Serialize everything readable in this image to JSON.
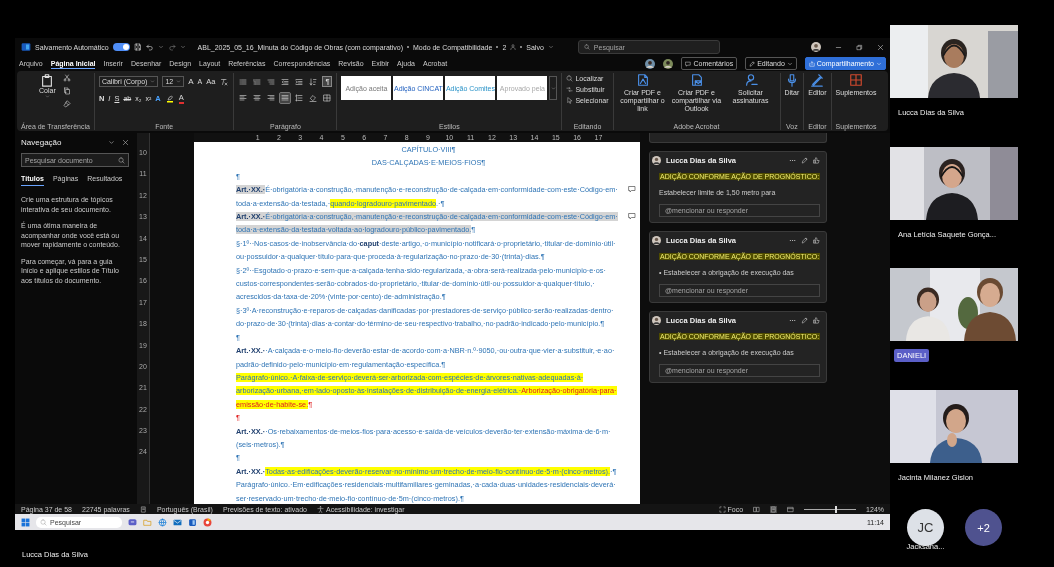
{
  "title_bar": {
    "autosave_label": "Salvamento Automático",
    "autosave_on": true,
    "document_title": "ABL_2025_05_16_Minuta do Código de Obras (com comparativo)",
    "mode": "Modo de Compatibilidade",
    "sensitivity": "2",
    "status": "Salvo",
    "search_placeholder": "Pesquisar"
  },
  "menu_tabs": [
    {
      "label": "Arquivo",
      "selected": false
    },
    {
      "label": "Página Inicial",
      "selected": true
    },
    {
      "label": "Inserir",
      "selected": false
    },
    {
      "label": "Desenhar",
      "selected": false
    },
    {
      "label": "Design",
      "selected": false
    },
    {
      "label": "Layout",
      "selected": false
    },
    {
      "label": "Referências",
      "selected": false
    },
    {
      "label": "Correspondências",
      "selected": false
    },
    {
      "label": "Revisão",
      "selected": false
    },
    {
      "label": "Exibir",
      "selected": false
    },
    {
      "label": "Ajuda",
      "selected": false
    },
    {
      "label": "Acrobat",
      "selected": false
    }
  ],
  "header_buttons": [
    {
      "label": "Comentários",
      "kind": "outline"
    },
    {
      "label": "Editando",
      "kind": "dropdown"
    },
    {
      "label": "Compartilhamento",
      "kind": "primary"
    }
  ],
  "ribbon": {
    "clipboard": {
      "paste": "Colar",
      "label": "Área de Transferência"
    },
    "font": {
      "name": "Calibri (Corpo)",
      "size": "12",
      "size_buttons": [
        "A",
        "A"
      ],
      "case_button": "Aa",
      "format_buttons": [
        {
          "text": "N",
          "kind": "bold"
        },
        {
          "text": "I",
          "kind": "italic"
        },
        {
          "text": "S",
          "kind": "underline"
        },
        {
          "text": "ab",
          "kind": "strike"
        },
        {
          "text": "x₂",
          "kind": "sub"
        },
        {
          "text": "x²",
          "kind": "sup"
        }
      ],
      "effects_letter": "A",
      "color_letter": "A",
      "label": "Fonte"
    },
    "paragraph": {
      "label": "Parágrafo",
      "show_marks": {
        "glyph": "¶",
        "on": true
      },
      "alignment_buttons": [
        {
          "selected": false
        },
        {
          "selected": false
        },
        {
          "selected": false
        },
        {
          "selected": true
        }
      ]
    },
    "styles": {
      "label": "Estilos",
      "items": [
        {
          "label": "Adição aceita",
          "kind": "grey"
        },
        {
          "label": "Adição CINCAT",
          "kind": "blue"
        },
        {
          "label": "Adição Comites",
          "kind": "cyan"
        },
        {
          "label": "Aprovado pela",
          "kind": "faint"
        }
      ]
    },
    "editing": {
      "label": "Editando",
      "items": [
        "Localizar",
        "Substituir",
        "Selecionar"
      ]
    },
    "acrobat": {
      "label": "Adobe Acrobat",
      "items": [
        "Criar PDF e compartilhar o link",
        "Criar PDF e compartilhar via Outlook",
        "Solicitar assinaturas"
      ]
    },
    "voice": {
      "label": "Voz",
      "button": "Ditar"
    },
    "editor": {
      "label": "Editor",
      "button": "Editor"
    },
    "addins": {
      "label": "Suplementos",
      "button": "Suplementos"
    }
  },
  "navigation": {
    "title": "Navegação",
    "search_placeholder": "Pesquisar documento",
    "tabs": [
      {
        "label": "Títulos",
        "selected": true
      },
      {
        "label": "Páginas",
        "selected": false
      },
      {
        "label": "Resultados",
        "selected": false
      }
    ],
    "messages": [
      "Crie uma estrutura de tópicos interativa de seu documento.",
      "É uma ótima maneira de acompanhar onde você está ou mover rapidamente o conteúdo.",
      "Para começar, vá para a guia Início e aplique estilos de Título aos títulos do documento."
    ]
  },
  "rulers": {
    "horizontal": [
      "1",
      "2",
      "3",
      "4",
      "5",
      "6",
      "7",
      "8",
      "9",
      "10",
      "11",
      "12",
      "13",
      "14",
      "15",
      "16",
      "17"
    ],
    "vertical": [
      "10",
      "11",
      "12",
      "13",
      "14",
      "15",
      "16",
      "17",
      "18",
      "19",
      "20",
      "21",
      "22",
      "23",
      "24"
    ]
  },
  "document": {
    "paragraphs": [
      {
        "centered": true,
        "runs": [
          {
            "text": "CAPÍTULO·VIII¶",
            "kind": "plain"
          }
        ]
      },
      {
        "centered": true,
        "runs": [
          {
            "text": "DAS·CALÇADAS·E·MEIOS·FIOS¶",
            "kind": "plain"
          }
        ]
      },
      {
        "centered": false,
        "runs": [
          {
            "text": "¶",
            "kind": "plain"
          }
        ]
      },
      {
        "centered": false,
        "comment": true,
        "runs": [
          {
            "text": "Art.·XX.·",
            "bold": true,
            "kind": "shaded"
          },
          {
            "text": "É·obrigatória·a·construção,·manutenção·e·reconstrução·de·calçada·em·conformidade·com·este·Código·em·toda·a·extensão·da·testada,·",
            "kind": "plain"
          },
          {
            "text": "quando·logradouro·pavimentado",
            "kind": "highlighted"
          },
          {
            "text": ".·¶",
            "kind": "plain"
          }
        ]
      },
      {
        "centered": false,
        "comment": true,
        "runs": [
          {
            "text": "Art.·XX.·",
            "bold": true,
            "kind": "shaded"
          },
          {
            "text": "É·obrigatória·a·construção,·manutenção·e·reconstrução·de·calçada·em·conformidade·com·este·Código·em·toda·a·extensão·da·testada·voltada·ao·logradouro·público·pavimentado.",
            "kind": "shaded"
          },
          {
            "text": "¶",
            "kind": "plain"
          }
        ]
      },
      {
        "centered": false,
        "runs": [
          {
            "text": "§·1º··Nos·casos·de·inobservância·do·",
            "kind": "plain"
          },
          {
            "text": "caput",
            "bold": true,
            "kind": "plain"
          },
          {
            "text": "·deste·artigo,·o·município·notificará·o·proprietário,·titular·de·domínio·útil·ou·possuidor·a·qualquer·título·para·que·proceda·à·regularização·no·prazo·de·30·(trinta)·dias.¶",
            "kind": "plain"
          }
        ]
      },
      {
        "centered": false,
        "runs": [
          {
            "text": "§·2º··Esgotado·o·prazo·e·sem·que·a·calçada·tenha·sido·regularizada,·a·obra·será·realizada·pelo·município·e·os·custos·correspondentes·serão·cobrados·do·proprietário,·titular·de·domínio·útil·ou·possuidor·a·qualquer·título,·acrescidos·da·taxa·de·20%·(vinte·por·cento)·de·administração.¶",
            "kind": "plain"
          }
        ]
      },
      {
        "centered": false,
        "runs": [
          {
            "text": "§·3º·A·reconstrução·e·reparos·de·calçadas·danificadas·por·prestadores·de·serviço·público·serão·realizadas·dentro·do·prazo·de·30·(trinta)·dias·a·contar·do·término·de·seu·respectivo·trabalho,·no·padrão·indicado·pelo·município.¶",
            "kind": "plain"
          }
        ]
      },
      {
        "centered": false,
        "runs": [
          {
            "text": "¶",
            "kind": "plain"
          }
        ]
      },
      {
        "centered": false,
        "runs": [
          {
            "text": "Art.·XX.·",
            "bold": true,
            "kind": "plain"
          },
          {
            "text": "·A·calçada·e·o·meio-fio·deverão·estar·de·acordo·com·a·NBR·n.º·9050,·ou·outra·que·vier·a·substituir,·e·ao·padrão·definido·pelo·município·em·regulamentação·específica.¶",
            "kind": "plain"
          }
        ]
      },
      {
        "centered": false,
        "runs": [
          {
            "text": "Parágrafo·único.·A·faixa·de·serviço·deverá·ser·arborizada·com·espécies·de·árvores·nativas·adequadas·à·arborização·urbana,·em·lado·oposto·às·instalações·de·distribuição·de·energia·elétrica.·",
            "kind": "highlighted"
          },
          {
            "text": "Arborização·obrigatória·para·emissão·de·habite-se.",
            "red": true,
            "kind": "highlighted"
          },
          {
            "text": "¶",
            "red": true,
            "kind": "plain"
          }
        ]
      },
      {
        "centered": false,
        "runs": [
          {
            "text": "¶",
            "red": true,
            "kind": "plain"
          }
        ]
      },
      {
        "centered": false,
        "runs": [
          {
            "text": "Art.·XX.·",
            "bold": true,
            "kind": "plain"
          },
          {
            "text": "·Os·rebaixamentos·de·meios-fios·para·acesso·e·saída·de·veículos·deverão·ter·extensão·máxima·de·6·m·(seis·metros).¶",
            "kind": "plain"
          }
        ]
      },
      {
        "centered": false,
        "runs": [
          {
            "text": "¶",
            "kind": "plain"
          }
        ]
      },
      {
        "centered": false,
        "runs": [
          {
            "text": "Art.·XX.·",
            "bold": true,
            "kind": "plain"
          },
          {
            "text": "Todas·as·edificações·deverão·reservar·no·mínimo·um·trecho·de·meio-fio·contínuo·de·5·m·(cinco·metros).",
            "kind": "highlighted"
          },
          {
            "text": "·¶",
            "kind": "plain"
          }
        ]
      },
      {
        "centered": false,
        "runs": [
          {
            "text": "Parágrafo·único.·Em·edificações·residenciais·multifamiliares·geminadas,·a·cada·duas·unidades·residenciais·deverá·ser·reservado·um·trecho·de·meio-fio·contínuo·de·5m·(cinco·metros).¶",
            "kind": "plain"
          }
        ]
      }
    ]
  },
  "comments": [
    {
      "author": "Lucca Dias da Silva",
      "heading": "ADIÇÃO CONFORME AÇÃO DE PROGNÓSTICO:",
      "body": "Estabelecer limite de 1,50 metro para",
      "reply_placeholder": "@mencionar ou responder"
    },
    {
      "author": "Lucca Dias da Silva",
      "heading": "ADIÇÃO CONFORME AÇÃO DE PROGNÓSTICO:",
      "body": "• Estabelecer a obrigação de execução das",
      "reply_placeholder": "@mencionar ou responder"
    },
    {
      "author": "Lucca Dias da Silva",
      "heading": "ADIÇÃO CONFORME AÇÃO DE PROGNÓSTICO:",
      "body": "• Estabelecer a obrigação de execução das",
      "reply_placeholder": "@mencionar ou responder"
    }
  ],
  "status_bar": {
    "page": "Página 37 de 58",
    "words": "22745 palavras",
    "language": "Português (Brasil)",
    "predictions": "Previsões de texto: ativado",
    "accessibility": "Acessibilidade: investigar",
    "focus": "Foco",
    "zoom_slider": {
      "level": 0.62
    },
    "zoom": "124%"
  },
  "taskbar": {
    "search_placeholder": "Pesquisar",
    "time": "11:14"
  },
  "participants": [
    {
      "name": "Lucca Dias da Silva",
      "kind": "plain"
    },
    {
      "name": "Ana Letícia Saquete Gonça...",
      "kind": "plain"
    },
    {
      "name": "DANIELI",
      "kind": "badge"
    },
    {
      "name": "Jacinta Milanez Gislon",
      "kind": "plain"
    }
  ],
  "more_participants": [
    {
      "initials": "JC",
      "name": "Jacksana..."
    },
    {
      "initials": "+2"
    }
  ],
  "presenter": "Lucca Dias da Silva"
}
